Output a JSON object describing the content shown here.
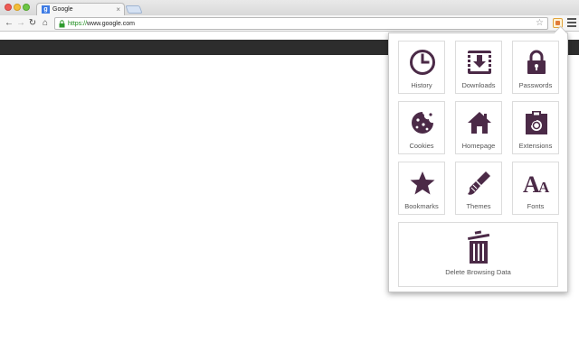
{
  "browser": {
    "tab": {
      "favicon_letter": "g",
      "title": "Google",
      "close_glyph": "×"
    },
    "toolbar": {
      "back_glyph": "←",
      "forward_glyph": "→",
      "reload_glyph": "↻",
      "home_glyph": "⌂"
    },
    "omnibox": {
      "scheme": "https://",
      "host": "www.google.com",
      "star_glyph": "☆"
    }
  },
  "popup": {
    "icon_color": "#4b2a47",
    "tiles": [
      {
        "label": "History",
        "icon": "clock-icon"
      },
      {
        "label": "Downloads",
        "icon": "download-icon"
      },
      {
        "label": "Passwords",
        "icon": "lock-icon"
      },
      {
        "label": "Cookies",
        "icon": "cookie-icon"
      },
      {
        "label": "Homepage",
        "icon": "home-icon"
      },
      {
        "label": "Extensions",
        "icon": "extension-icon"
      },
      {
        "label": "Bookmarks",
        "icon": "star-icon"
      },
      {
        "label": "Themes",
        "icon": "paintbrush-icon"
      },
      {
        "label": "Fonts",
        "icon": "fonts-icon"
      }
    ],
    "delete_tile": {
      "label": "Delete Browsing Data",
      "icon": "trash-icon"
    }
  }
}
